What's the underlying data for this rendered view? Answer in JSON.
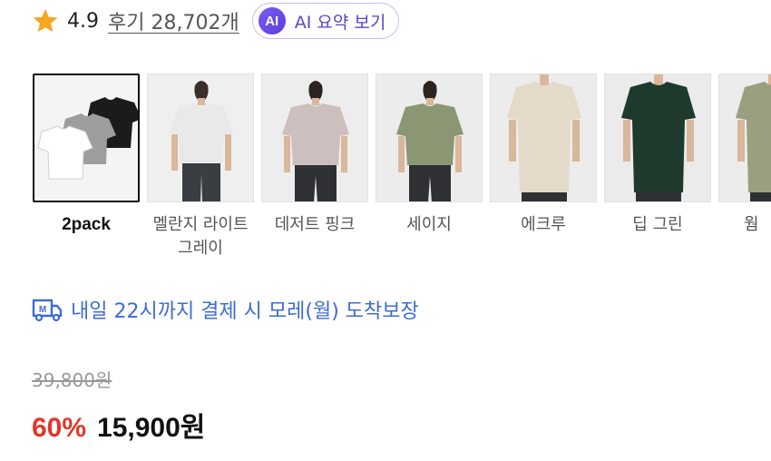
{
  "rating": {
    "value": "4.9",
    "review_link": "후기 28,702개",
    "ai_badge": "AI",
    "ai_button": "AI 요약 보기"
  },
  "colors": {
    "accent_purple": "#5b45c7",
    "delivery_blue": "#3d6bd6",
    "discount_red": "#e2362b",
    "star_orange": "#f5a623"
  },
  "options": [
    {
      "label": "2pack",
      "selected": true,
      "shirt": "#ffffff"
    },
    {
      "label": "멜란지 라이트 그레이",
      "selected": false,
      "shirt": "#e9e9ea"
    },
    {
      "label": "데저트 핑크",
      "selected": false,
      "shirt": "#cdbfbd"
    },
    {
      "label": "세이지",
      "selected": false,
      "shirt": "#8b9673"
    },
    {
      "label": "에크루",
      "selected": false,
      "shirt": "#e3dac9"
    },
    {
      "label": "딥 그린",
      "selected": false,
      "shirt": "#1f3a2c"
    },
    {
      "label": "웜 ",
      "selected": false,
      "shirt": "#9aa07f"
    }
  ],
  "delivery": {
    "icon": "truck-icon",
    "text": "내일 22시까지 결제 시 모레(월) 도착보장"
  },
  "price": {
    "original": "39,800원",
    "discount": "60%",
    "sale": "15,900원"
  }
}
